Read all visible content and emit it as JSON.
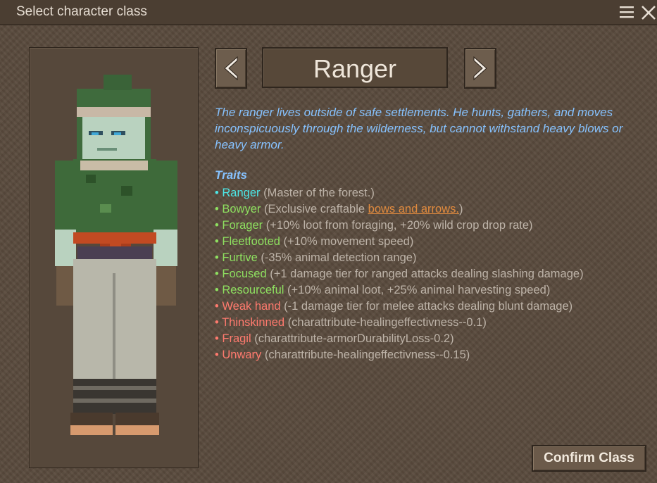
{
  "dialog": {
    "title": "Select character class",
    "menu_icon": "hamburger-menu-icon",
    "close_icon": "close-icon"
  },
  "class_selector": {
    "prev_icon": "chevron-left-icon",
    "next_icon": "chevron-right-icon",
    "class_name": "Ranger"
  },
  "description": "The ranger lives outside of safe settlements. He hunts, gathers, and moves inconspicuously through the wilderness, but cannot withstand heavy blows or heavy armor.",
  "traits_heading": "Traits",
  "traits": [
    {
      "bullet": "• ",
      "name": "Ranger",
      "desc": "(Master of the forest.)",
      "color": "#4de8e8"
    },
    {
      "bullet": "• ",
      "name": "Bowyer",
      "desc_pre": "(Exclusive craftable ",
      "link": "bows and arrows.",
      "desc_post": ")",
      "color": "#8ee060"
    },
    {
      "bullet": "• ",
      "name": "Forager",
      "desc": "(+10% loot from foraging, +20% wild crop drop rate)",
      "color": "#8ee060"
    },
    {
      "bullet": "• ",
      "name": "Fleetfooted",
      "desc": "(+10% movement speed)",
      "color": "#8ee060"
    },
    {
      "bullet": "• ",
      "name": "Furtive",
      "desc": "(-35% animal detection range)",
      "color": "#8ee060"
    },
    {
      "bullet": "• ",
      "name": "Focused",
      "desc": "(+1 damage tier for ranged attacks dealing slashing damage)",
      "color": "#8ee060"
    },
    {
      "bullet": "• ",
      "name": "Resourceful",
      "desc": "(+10% animal loot, +25% animal harvesting speed)",
      "color": "#8ee060"
    },
    {
      "bullet": "• ",
      "name": "Weak hand",
      "desc": "(-1 damage tier for melee attacks dealing blunt damage)",
      "color": "#ff7a6e"
    },
    {
      "bullet": "• ",
      "name": "Thinskinned",
      "desc": "(charattribute-healingeffectivness--0.1)",
      "color": "#ff7a6e"
    },
    {
      "bullet": "• ",
      "name": "Fragil",
      "desc": "(charattribute-armorDurabilityLoss-0.2)",
      "color": "#ff7a6e"
    },
    {
      "bullet": "• ",
      "name": "Unwary",
      "desc": "(charattribute-healingeffectivness--0.15)",
      "color": "#ff7a6e"
    }
  ],
  "confirm_label": "Confirm Class"
}
